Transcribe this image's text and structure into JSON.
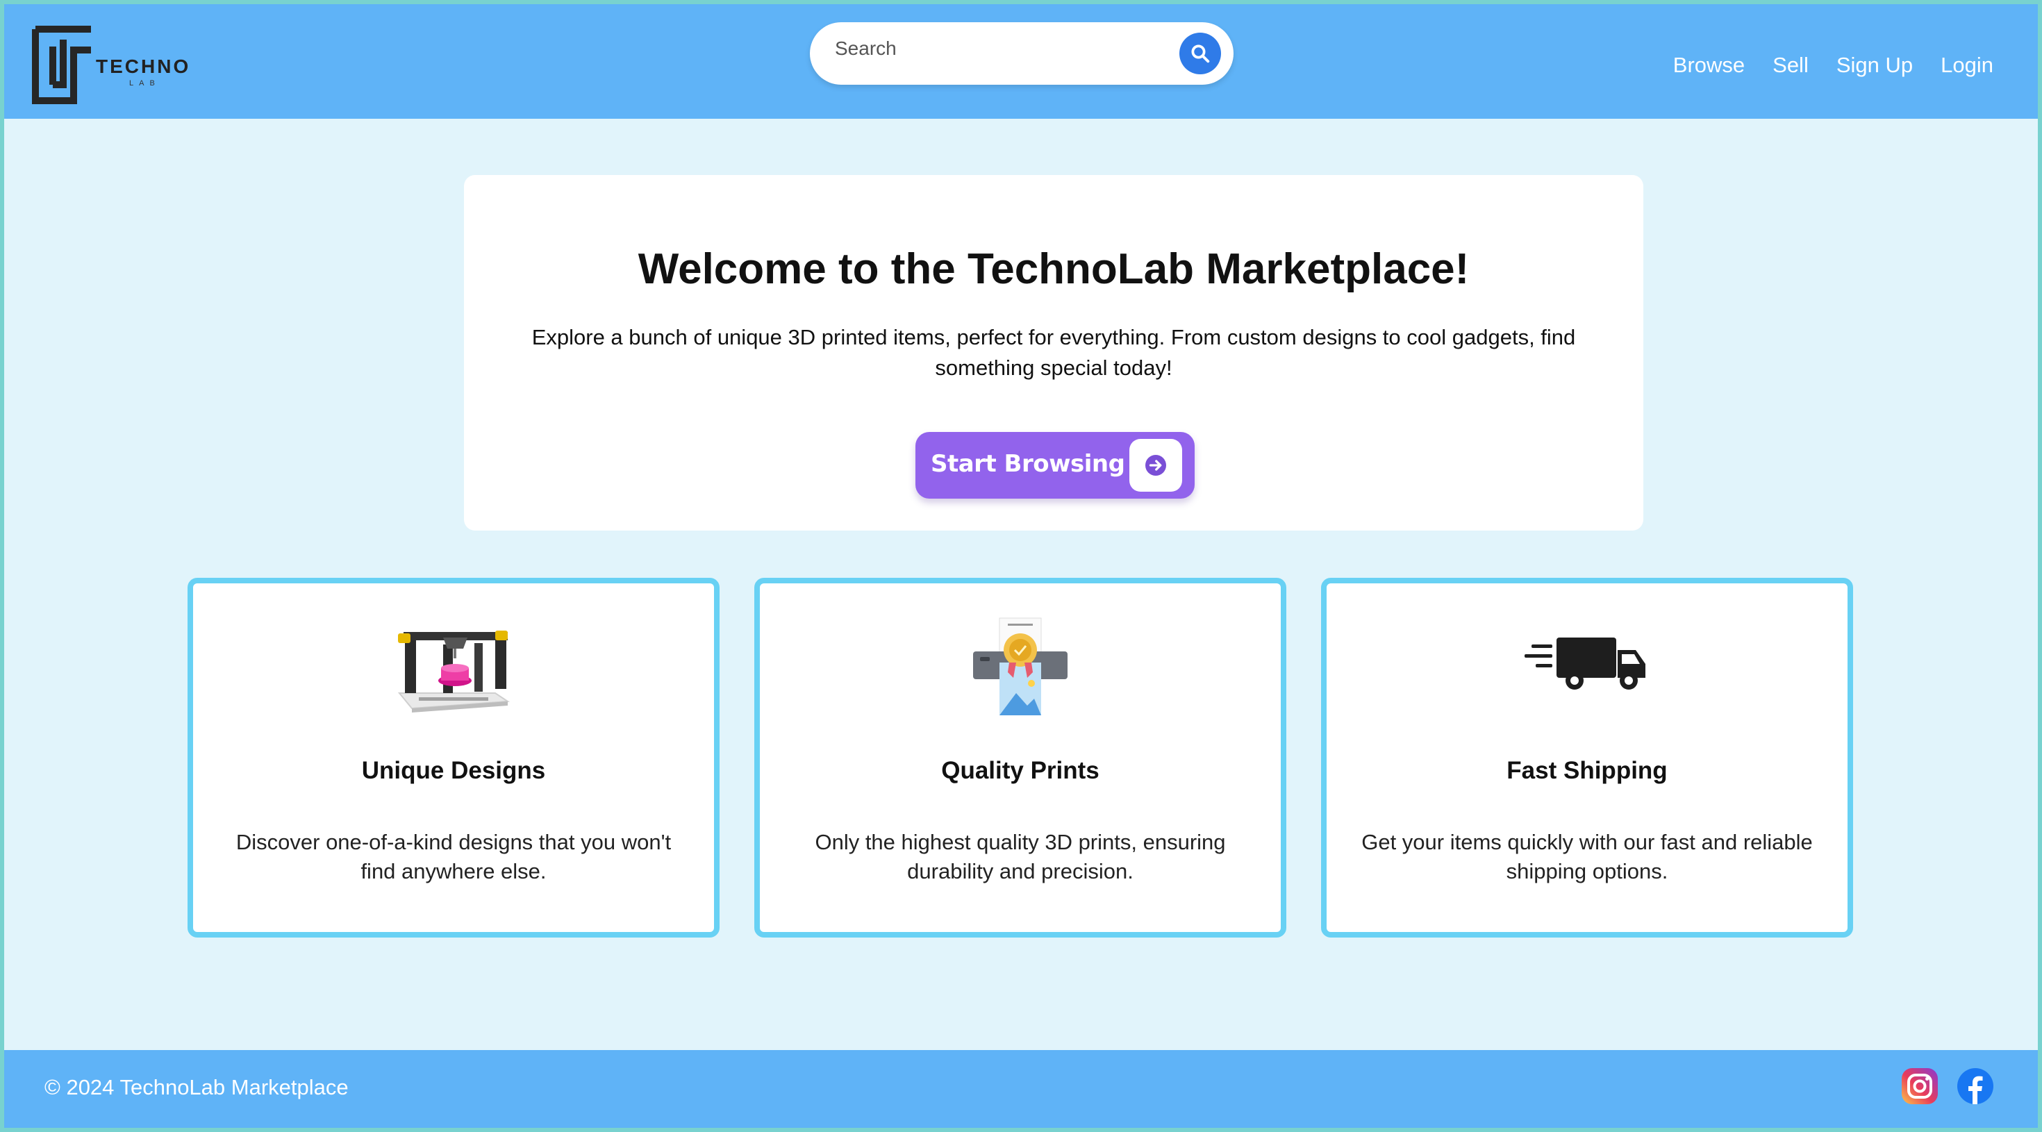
{
  "header": {
    "logo_word": "TECHNO",
    "logo_sub": "LAB",
    "search_placeholder": "Search",
    "nav": [
      "Browse",
      "Sell",
      "Sign Up",
      "Login"
    ]
  },
  "hero": {
    "title": "Welcome to the TechnoLab Marketplace!",
    "description": "Explore a bunch of unique 3D printed items, perfect for everything. From custom designs to cool gadgets, find something special today!",
    "cta_label": "Start Browsing"
  },
  "features": [
    {
      "icon": "3d-printer-icon",
      "title": "Unique Designs",
      "text": "Discover one-of-a-kind designs that you won't find anywhere else."
    },
    {
      "icon": "quality-print-icon",
      "title": "Quality Prints",
      "text": "Only the highest quality 3D prints, ensuring durability and precision."
    },
    {
      "icon": "delivery-truck-icon",
      "title": "Fast Shipping",
      "text": "Get your items quickly with our fast and reliable shipping options."
    }
  ],
  "footer": {
    "copyright": "© 2024 TechnoLab Marketplace",
    "social": [
      "instagram-icon",
      "facebook-icon"
    ]
  },
  "colors": {
    "header_bg": "#5fb3f7",
    "page_bg": "#e1f4fb",
    "accent_purple": "#9263ec",
    "card_border": "#68d1f4",
    "search_button": "#2f7be8"
  }
}
